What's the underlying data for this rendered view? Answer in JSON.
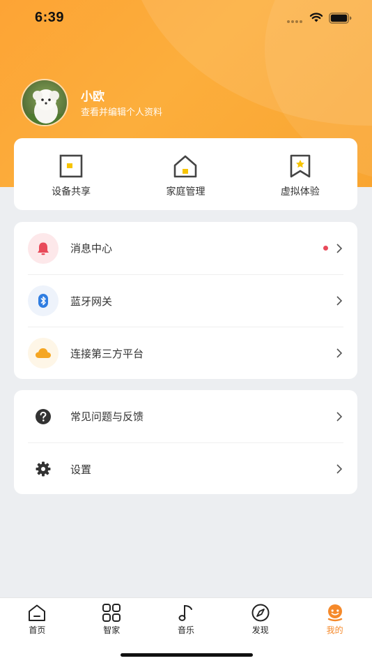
{
  "status_bar": {
    "time": "6:39"
  },
  "profile": {
    "name": "小欧",
    "subtitle": "查看并编辑个人资料"
  },
  "quick_actions": [
    {
      "icon": "device-share-icon",
      "label": "设备共享"
    },
    {
      "icon": "home-management-icon",
      "label": "家庭管理"
    },
    {
      "icon": "virtual-experience-icon",
      "label": "虚拟体验"
    }
  ],
  "menu_group_1": [
    {
      "icon": "bell-icon",
      "label": "消息中心",
      "has_badge": true,
      "icon_bg": "#fde8ea",
      "icon_color": "#e84a5a"
    },
    {
      "icon": "bluetooth-icon",
      "label": "蓝牙网关",
      "icon_bg": "#eef3fb",
      "icon_color": "#2f7de1"
    },
    {
      "icon": "cloud-icon",
      "label": "连接第三方平台",
      "icon_bg": "#fef6e7",
      "icon_color": "#f5a623"
    }
  ],
  "menu_group_2": [
    {
      "icon": "help-icon",
      "label": "常见问题与反馈"
    },
    {
      "icon": "settings-gear-icon",
      "label": "设置"
    }
  ],
  "tab_bar": {
    "tabs": [
      {
        "icon": "home-icon",
        "label": "首页"
      },
      {
        "icon": "smart-home-grid-icon",
        "label": "智家"
      },
      {
        "icon": "music-note-icon",
        "label": "音乐"
      },
      {
        "icon": "compass-icon",
        "label": "发现"
      },
      {
        "icon": "profile-icon",
        "label": "我的",
        "active": true
      }
    ],
    "active_color": "#f5892a"
  },
  "colors": {
    "header": "#fca63a",
    "accent": "#f5892a",
    "background": "#eceef1"
  }
}
